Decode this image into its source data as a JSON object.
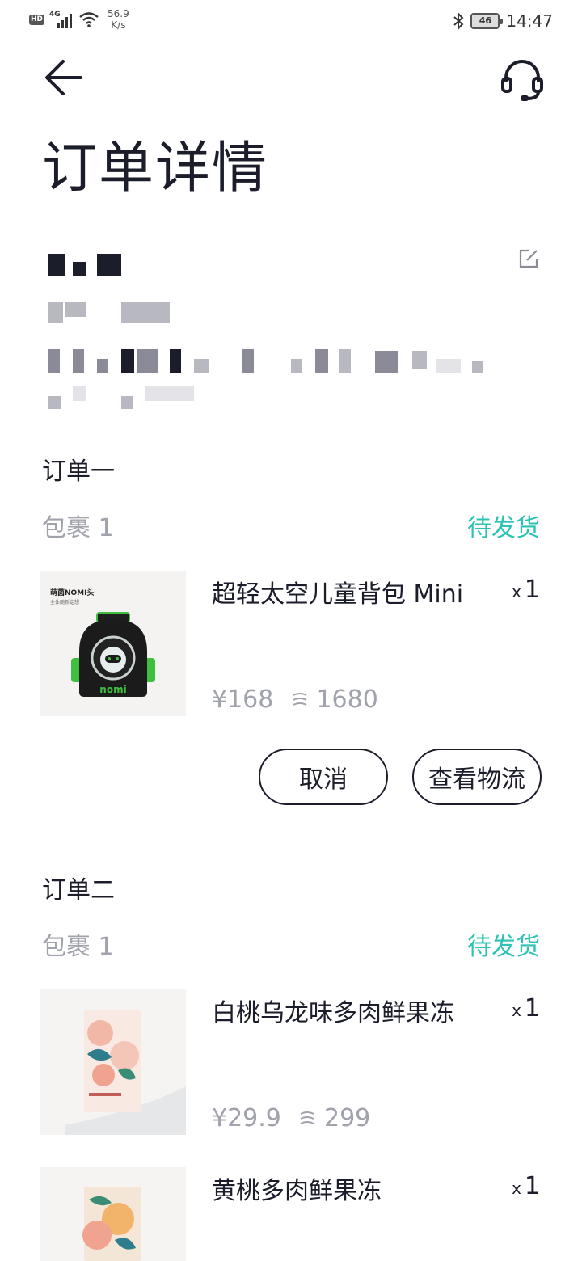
{
  "status_bar": {
    "hd": "HD",
    "network": "4G",
    "speed_value": "56.9",
    "speed_unit": "K/s",
    "battery": "46",
    "time": "14:47"
  },
  "header": {
    "back_icon": "arrow-left-icon",
    "support_icon": "headset-icon",
    "title": "订单详情"
  },
  "address": {
    "edit_icon": "edit-icon"
  },
  "orders": [
    {
      "title": "订单一",
      "package": "包裹 1",
      "status": "待发货",
      "items": [
        {
          "name": "超轻太空儿童背包 Mini",
          "qty_prefix": "x",
          "qty": "1",
          "price": "¥168",
          "coins": "1680",
          "image_text": "萌菌NOMI头",
          "image_subtext": "全体随新定想",
          "brand": "nomi"
        }
      ],
      "actions": [
        "取消",
        "查看物流"
      ]
    },
    {
      "title": "订单二",
      "package": "包裹 1",
      "status": "待发货",
      "items": [
        {
          "name": "白桃乌龙味多肉鲜果冻",
          "qty_prefix": "x",
          "qty": "1",
          "price": "¥29.9",
          "coins": "299"
        },
        {
          "name": "黄桃多肉鲜果冻",
          "qty_prefix": "x",
          "qty": "1"
        }
      ]
    }
  ],
  "colors": {
    "accent": "#2cc3b5",
    "text": "#1c1d2b",
    "muted": "#a0a2ac"
  }
}
